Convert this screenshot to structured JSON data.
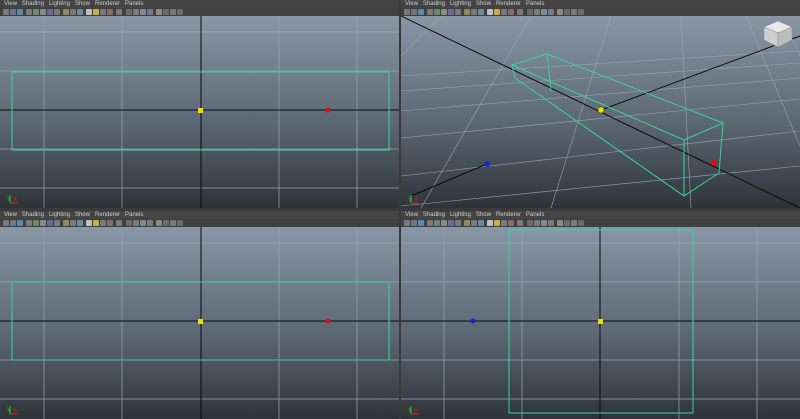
{
  "panels": [
    {
      "id": "top-left",
      "menu": [
        "View",
        "Shading",
        "Lighting",
        "Show",
        "Renderer",
        "Panels"
      ],
      "gizmo": {
        "x": "X",
        "y": "Y"
      }
    },
    {
      "id": "top-right",
      "menu": [
        "View",
        "Shading",
        "Lighting",
        "Show",
        "Renderer",
        "Panels"
      ],
      "gizmo": {
        "x": "X",
        "y": "Y"
      }
    },
    {
      "id": "bottom-left",
      "menu": [
        "View",
        "Shading",
        "Lighting",
        "Show",
        "Renderer",
        "Panels"
      ],
      "gizmo": {
        "x": "X",
        "y": "Y"
      }
    },
    {
      "id": "bottom-right",
      "menu": [
        "View",
        "Shading",
        "Lighting",
        "Show",
        "Renderer",
        "Panels"
      ],
      "gizmo": {
        "x": "X",
        "y": "Y"
      }
    }
  ],
  "colors": {
    "selection": "#33d6a0",
    "grid": "#9aa5b1",
    "axis": "#0a0a0a",
    "pivot_yellow": "#e8e000",
    "pivot_red": "#e01010",
    "pivot_blue": "#1828d0",
    "gizmo_x": "#e02020",
    "gizmo_y": "#20d020"
  },
  "icons": [
    "select-tool-icon",
    "camera-icon",
    "bookmark-icon",
    "grid-toggle-icon",
    "wireframe-icon",
    "smooth-shade-icon",
    "texture-icon",
    "light-icon",
    "shadow-icon",
    "xray-icon",
    "isolate-icon",
    "hud-icon",
    "resolution-icon"
  ],
  "view_cube": "view-cube-icon"
}
